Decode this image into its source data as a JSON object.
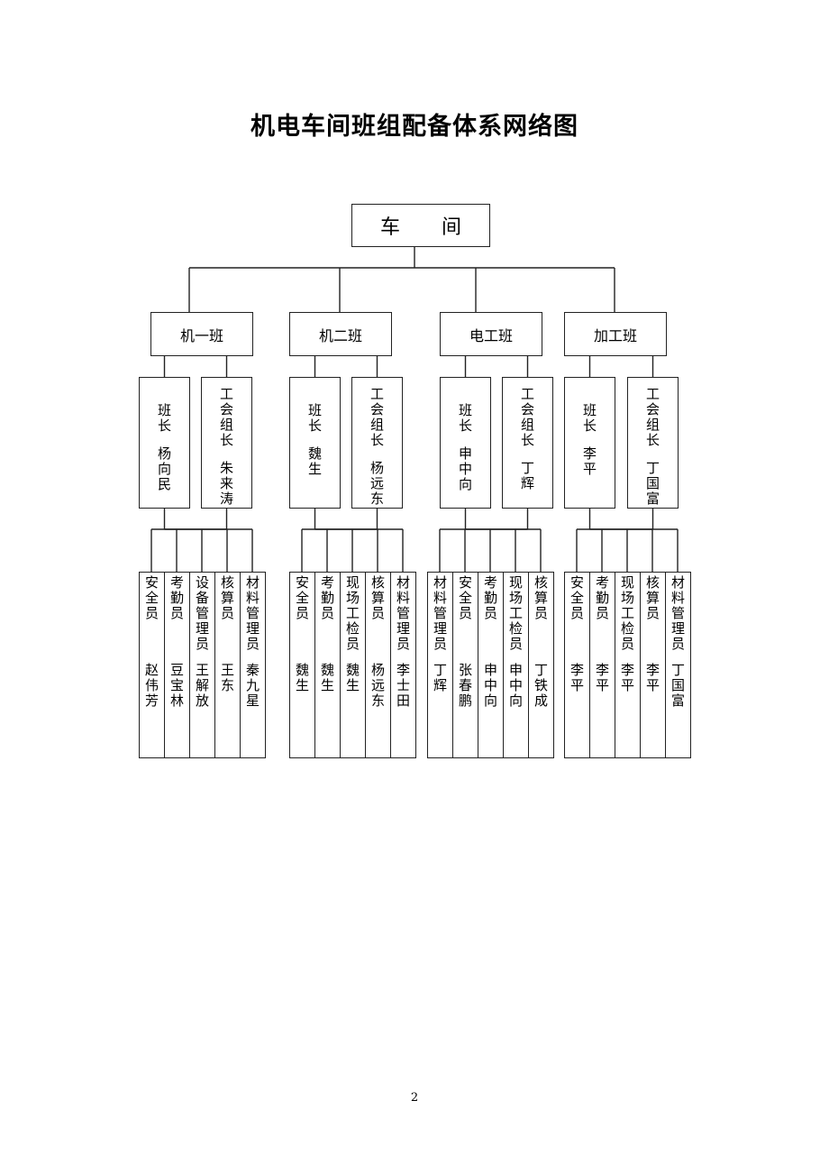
{
  "title": "机电车间班组配备体系网络图",
  "root": {
    "label_a": "车",
    "label_b": "间"
  },
  "teams": [
    {
      "name": "机一班",
      "leader": {
        "role": "班长",
        "person": "杨向民"
      },
      "union_leader": {
        "role": "工会组长",
        "person": "朱来涛"
      },
      "members": [
        {
          "role": "安全员",
          "person": "赵伟芳"
        },
        {
          "role": "考勤员",
          "person": "豆宝林"
        },
        {
          "role": "设备管理员",
          "person": "王解放"
        },
        {
          "role": "核算员",
          "person": "王东"
        },
        {
          "role": "材料管理员",
          "person": "秦九星"
        }
      ]
    },
    {
      "name": "机二班",
      "leader": {
        "role": "班长",
        "person": "魏生"
      },
      "union_leader": {
        "role": "工会组长",
        "person": "杨远东"
      },
      "members": [
        {
          "role": "安全员",
          "person": "魏生"
        },
        {
          "role": "考勤员",
          "person": "魏生"
        },
        {
          "role": "现场工检员",
          "person": "魏生"
        },
        {
          "role": "核算员",
          "person": "杨远东"
        },
        {
          "role": "材料管理员",
          "person": "李士田"
        }
      ]
    },
    {
      "name": "电工班",
      "leader": {
        "role": "班长",
        "person": "申中向"
      },
      "union_leader": {
        "role": "工会组长",
        "person": "丁辉"
      },
      "members": [
        {
          "role": "材料管理员",
          "person": "丁辉"
        },
        {
          "role": "安全员",
          "person": "张春鹏"
        },
        {
          "role": "考勤员",
          "person": "申中向"
        },
        {
          "role": "现场工检员",
          "person": "申中向"
        },
        {
          "role": "核算员",
          "person": "丁铁成"
        }
      ]
    },
    {
      "name": "加工班",
      "leader": {
        "role": "班长",
        "person": "李平"
      },
      "union_leader": {
        "role": "工会组长",
        "person": "丁国富"
      },
      "members": [
        {
          "role": "安全员",
          "person": "李平"
        },
        {
          "role": "考勤员",
          "person": "李平"
        },
        {
          "role": "现场工检员",
          "person": "李平"
        },
        {
          "role": "核算员",
          "person": "李平"
        },
        {
          "role": "材料管理员",
          "person": "丁国富"
        }
      ]
    }
  ],
  "page_number": "2"
}
